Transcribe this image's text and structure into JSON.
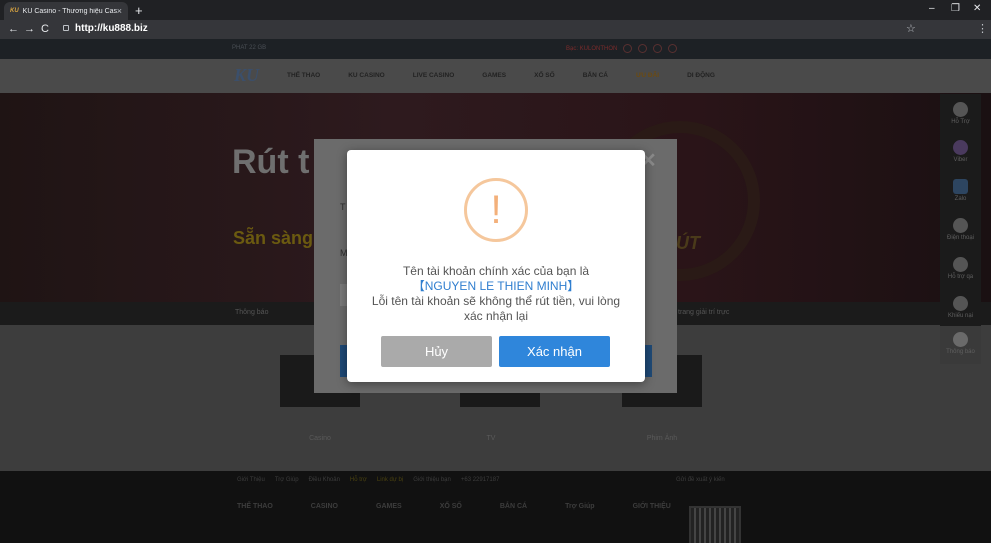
{
  "browser": {
    "tab_title": "KU Casino - Thương hiệu Casino",
    "tab_favicon": "KU",
    "tab_close": "×",
    "new_tab": "+",
    "url": "http://ku888.biz",
    "window_controls": [
      "–",
      "❐",
      "✕"
    ],
    "nav_icons": [
      "←",
      "→",
      "C"
    ]
  },
  "site": {
    "topbar_left": "PHAT 22 GB",
    "topbar_user": "Bạc: KULONTHON",
    "logo": "KU",
    "nav": [
      "THỂ THAO",
      "KU CASINO",
      "LIVE CASINO",
      "GAMES",
      "XỔ SỐ",
      "BẮN CÁ",
      "ƯU ĐÃI",
      "DI ĐỘNG"
    ],
    "banner_title": "Rút t",
    "banner_subtitle": "Sẵn sàng",
    "banner_wheel_text": "ÚT",
    "ticker_left": "Thông báo",
    "ticker_right": "trang giải trí trực",
    "cards": [
      "Casino",
      "TV",
      "Phim Ảnh"
    ],
    "footer_links": [
      "Giới Thiệu",
      "Trợ Giúp",
      "Điều Khoản",
      "Hỗ trợ",
      "Link dự bị",
      "Giới thiệu bạn",
      "+63 22917187"
    ],
    "footer_right": "Gửi đề xuất ý kiến",
    "footer_cats": [
      "THỂ THAO",
      "CASINO",
      "GAMES",
      "XỔ SỐ",
      "BẮN CÁ",
      "Trợ Giúp",
      "GIỚI THIỆU"
    ],
    "sidebar": [
      {
        "label": "Hỗ Trợ",
        "icon": "headset-icon"
      },
      {
        "label": "Viber",
        "icon": "viber-icon"
      },
      {
        "label": "Zalo",
        "icon": "zalo-icon"
      },
      {
        "label": "Điện thoại",
        "icon": "phone-icon"
      },
      {
        "label": "Hỗ trợ qa",
        "icon": "chat-icon"
      },
      {
        "label": "Khiếu nại",
        "icon": "edit-icon"
      },
      {
        "label": "Thông báo",
        "icon": "speaker-icon"
      }
    ]
  },
  "bg_modal": {
    "close": "✕",
    "label_1": "T",
    "label_2": "M"
  },
  "dialog": {
    "icon": "!",
    "line1": "Tên tài khoản chính xác của bạn là",
    "name": "【NGUYEN LE THIEN MINH】",
    "line3": "Lỗi tên tài khoản sẽ không thể rút tiền, vui lòng",
    "line4": "xác nhận lại",
    "cancel_label": "Hủy",
    "confirm_label": "Xác nhận"
  },
  "colors": {
    "warning": "#f3b07a",
    "confirm": "#2f86db",
    "cancel": "#aaaaaa",
    "name_highlight": "#2f7ecf"
  }
}
